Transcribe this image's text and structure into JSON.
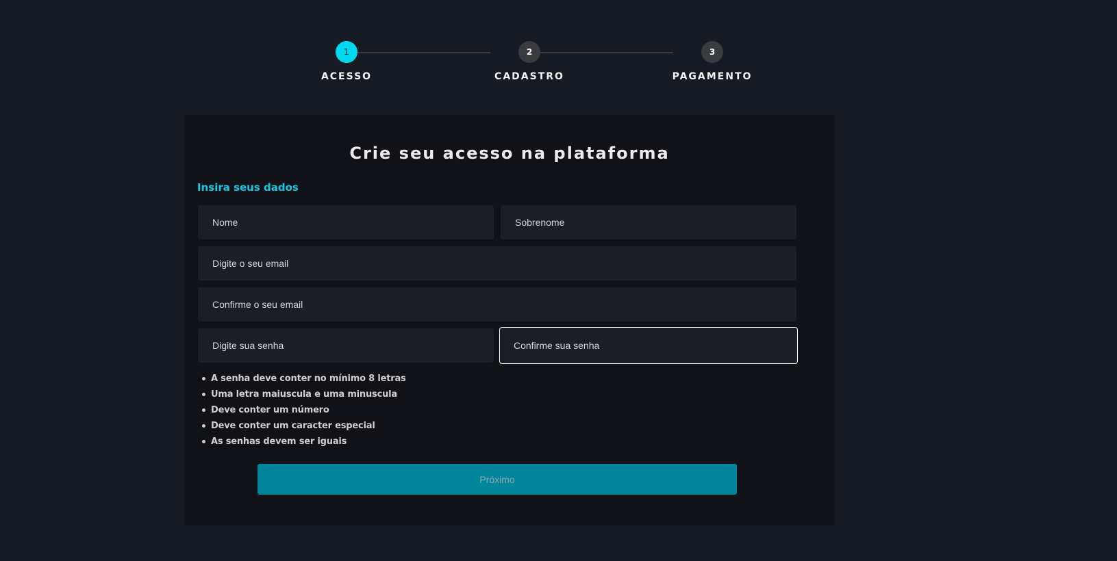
{
  "stepper": {
    "steps": [
      {
        "number": "1",
        "label": "ACESSO",
        "active": true
      },
      {
        "number": "2",
        "label": "CADASTRO",
        "active": false
      },
      {
        "number": "3",
        "label": "PAGAMENTO",
        "active": false
      }
    ]
  },
  "form": {
    "title": "Crie seu acesso na plataforma",
    "section_label": "Insira seus dados",
    "fields": {
      "first_name": {
        "placeholder": "Nome",
        "value": ""
      },
      "last_name": {
        "placeholder": "Sobrenome",
        "value": ""
      },
      "email": {
        "placeholder": "Digite o seu email",
        "value": ""
      },
      "email_confirm": {
        "placeholder": "Confirme o seu email",
        "value": ""
      },
      "password": {
        "placeholder": "Digite sua senha",
        "value": ""
      },
      "password_confirm": {
        "placeholder": "Confirme sua senha",
        "value": ""
      }
    },
    "password_rules": [
      "A senha deve conter no mínimo 8 letras",
      "Uma letra maiuscula e uma minuscula",
      "Deve conter um número",
      "Deve conter um caracter especial",
      "As senhas devem ser iguais"
    ],
    "next_label": "Próximo"
  },
  "colors": {
    "background": "#161a22",
    "card": "#101217",
    "accent": "#00d8f0",
    "button": "#02869c"
  }
}
